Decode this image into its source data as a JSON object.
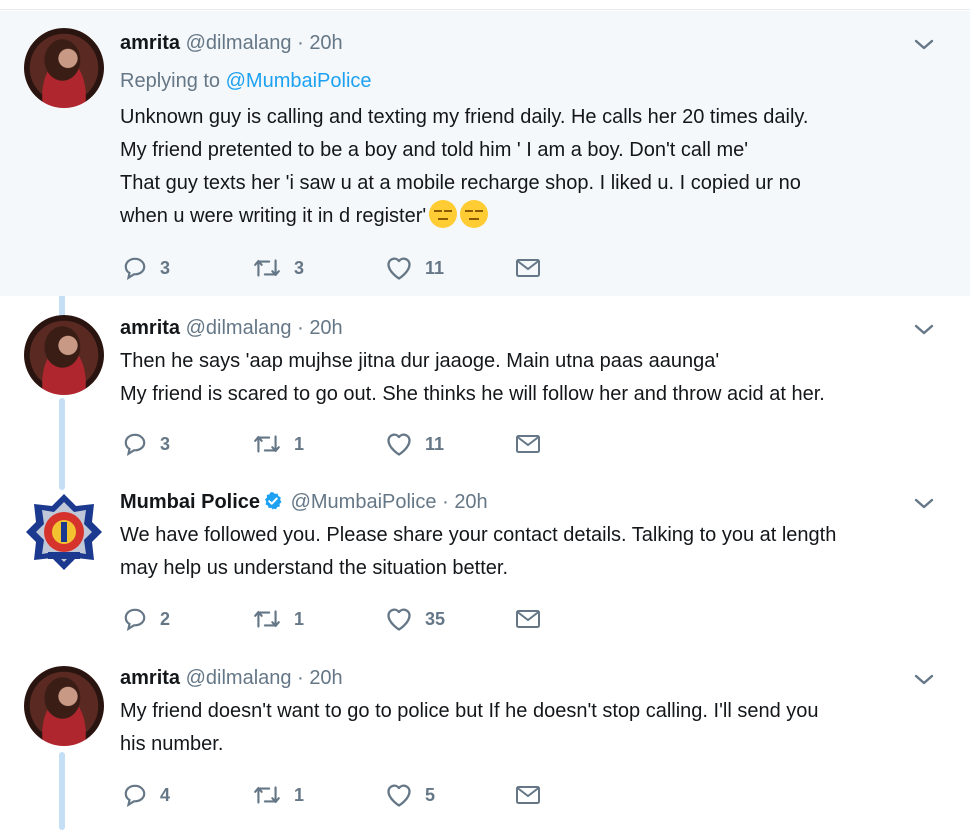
{
  "tweets": [
    {
      "name": "amrita",
      "handle": "@dilmalang",
      "dot": "·",
      "time": "20h",
      "replying_prefix": "Replying to",
      "replying_to": "@MumbaiPolice",
      "text": "Unknown guy is calling and texting my friend daily. He calls her 20 times daily.\nMy friend pretented to be a boy and told him ' I am a boy. Don't call me'\nThat guy texts her 'i saw u at a mobile recharge shop. I liked u. I copied ur no\nwhen u were writing it in d register'",
      "emojis": [
        "expressionless-emoji",
        "expressionless-emoji"
      ],
      "replies": "3",
      "retweets": "3",
      "likes": "11"
    },
    {
      "name": "amrita",
      "handle": "@dilmalang",
      "dot": "·",
      "time": "20h",
      "text": "Then he says 'aap mujhse jitna dur jaaoge. Main utna paas aaunga'\nMy friend is scared to go out. She thinks he will follow her and throw acid at her.",
      "replies": "3",
      "retweets": "1",
      "likes": "11"
    },
    {
      "name": "Mumbai Police",
      "verified": true,
      "handle": "@MumbaiPolice",
      "dot": "·",
      "time": "20h",
      "text": "We have followed you. Please share your contact details. Talking to you at length\nmay help us understand the situation better.",
      "replies": "2",
      "retweets": "1",
      "likes": "35"
    },
    {
      "name": "amrita",
      "handle": "@dilmalang",
      "dot": "·",
      "time": "20h",
      "text": "My friend doesn't want to go to police but If he doesn't stop calling. I'll send you\nhis number.",
      "replies": "4",
      "retweets": "1",
      "likes": "5"
    }
  ],
  "icons": {
    "reply": "reply-icon",
    "retweet": "retweet-icon",
    "like": "heart-icon",
    "message": "envelope-icon",
    "caret": "chevron-down-icon",
    "verified": "verified-badge-icon"
  },
  "colors": {
    "link": "#1da1f2",
    "muted": "#657786",
    "thread_line": "#c4dff5",
    "highlight_bg": "#f5f8fa"
  }
}
